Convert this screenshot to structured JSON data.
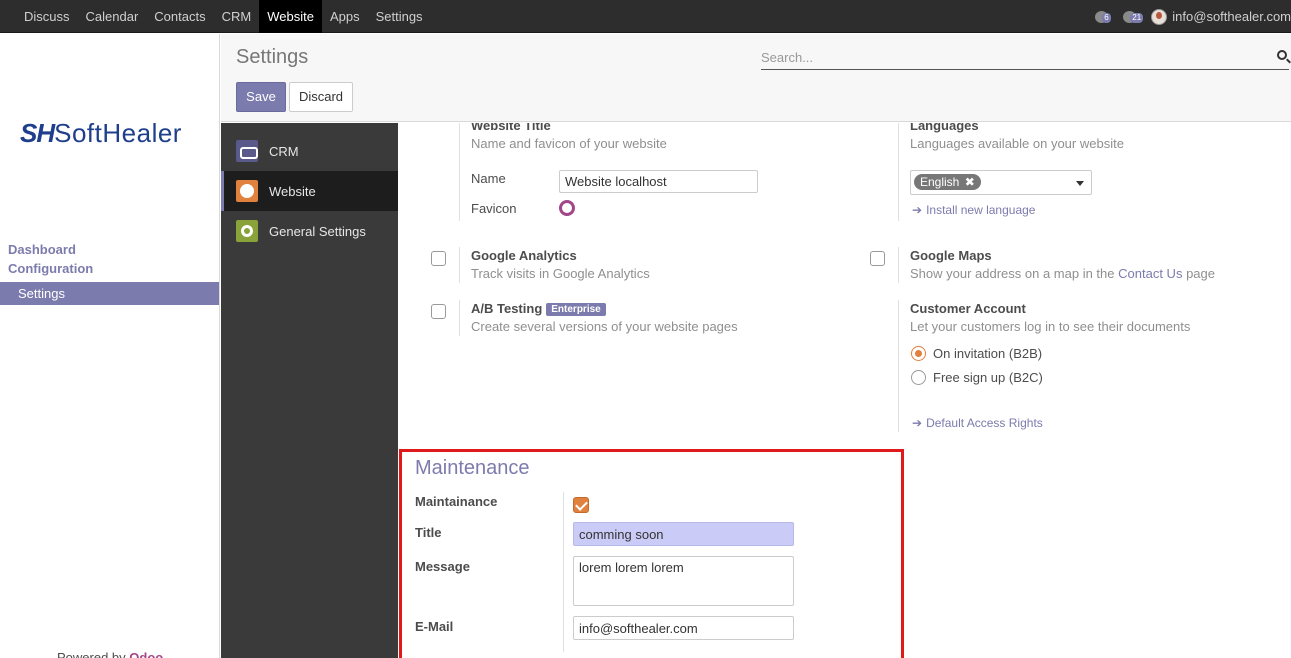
{
  "topnav": {
    "menu": [
      "Discuss",
      "Calendar",
      "Contacts",
      "CRM",
      "Website",
      "Apps",
      "Settings"
    ],
    "active": "Website",
    "activity_count": "6",
    "message_count": "21",
    "user": "info@softhealer.com"
  },
  "sidebar": {
    "logo_mark": "SH",
    "logo_text": "SoftHealer",
    "dashboard": "Dashboard",
    "configuration": "Configuration",
    "settings_item": "Settings",
    "powered_prefix": "Powered by",
    "powered_brand": "Odoo"
  },
  "control_panel": {
    "title": "Settings",
    "save_label": "Save",
    "discard_label": "Discard",
    "search_placeholder": "Search..."
  },
  "settings_nav": [
    {
      "label": "CRM",
      "icon": "handshake-icon"
    },
    {
      "label": "Website",
      "icon": "globe-icon",
      "active": true
    },
    {
      "label": "General Settings",
      "icon": "gear-icon"
    }
  ],
  "website_title": {
    "heading": "Website Title",
    "description": "Name and favicon of your website",
    "name_label": "Name",
    "name_value": "Website localhost",
    "favicon_label": "Favicon"
  },
  "languages": {
    "heading": "Languages",
    "description": "Languages available on your website",
    "selected": "English",
    "install_link": "Install new language"
  },
  "google_analytics": {
    "heading": "Google Analytics",
    "description": "Track visits in Google Analytics"
  },
  "google_maps": {
    "heading": "Google Maps",
    "description_prefix": "Show your address on a map in the",
    "description_link": "Contact Us",
    "description_suffix": "page"
  },
  "ab_testing": {
    "heading": "A/B Testing",
    "badge": "Enterprise",
    "description": "Create several versions of your website pages"
  },
  "customer_account": {
    "heading": "Customer Account",
    "description": "Let your customers log in to see their documents",
    "option_b2b": "On invitation (B2B)",
    "option_b2c": "Free sign up (B2C)",
    "selected": "On invitation (B2B)",
    "access_link": "Default Access Rights"
  },
  "maintenance": {
    "title": "Maintenance",
    "maintainance_label": "Maintainance",
    "maintainance_checked": true,
    "title_label": "Title",
    "title_value": "comming soon",
    "message_label": "Message",
    "message_value": "lorem lorem lorem",
    "email_label": "E-Mail",
    "email_value": "info@softhealer.com"
  },
  "colors": {
    "accent": "#7c7bad",
    "navbar": "#2d2d2d",
    "highlight_box": "#e01a1a",
    "checkbox_orange": "#e0813e"
  }
}
